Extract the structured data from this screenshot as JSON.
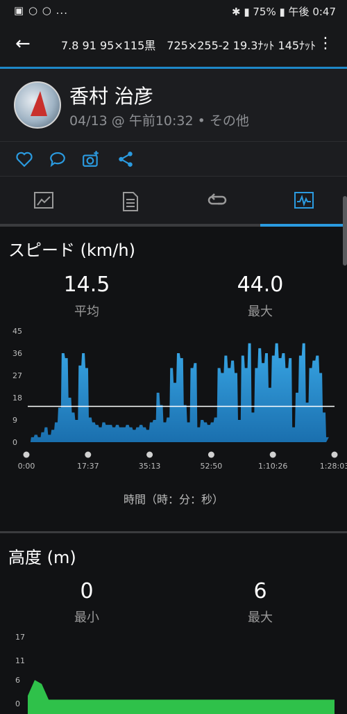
{
  "status_bar": {
    "left_icons": "▣ ○ ○ ...",
    "battery": "75%",
    "time": "午後 0:47"
  },
  "app_bar": {
    "title": "7.8 91 95×115黒　725×255-2 19.3ﾅｯﾄ 145ﾅｯﾄ"
  },
  "activity": {
    "user_name": "香村 治彦",
    "subtitle": "04/13 @ 午前10:32 • その他"
  },
  "speed": {
    "title": "スピード (km/h)",
    "avg_value": "14.5",
    "avg_label": "平均",
    "max_value": "44.0",
    "max_label": "最大",
    "x_axis_title": "時間（時：分：秒）"
  },
  "altitude": {
    "title": "高度 (m)",
    "min_value": "0",
    "min_label": "最小",
    "max_value": "6",
    "max_label": "最大"
  },
  "colors": {
    "accent": "#2b9be0",
    "speed_fill": "#2a8fcf",
    "altitude_fill": "#2fc14a"
  },
  "chart_data": [
    {
      "type": "area",
      "title": "スピード (km/h)",
      "xlabel": "時間（時：分：秒）",
      "ylabel": "",
      "ylim": [
        0,
        45
      ],
      "yticks": [
        0,
        9,
        18,
        27,
        36,
        45
      ],
      "xticks": [
        "0:00",
        "17:37",
        "35:13",
        "52:50",
        "1:10:26",
        "1:28:03"
      ],
      "average_line": 14.5,
      "x_minutes": [
        0,
        1,
        2,
        3,
        4,
        5,
        6,
        7,
        8,
        9,
        10,
        11,
        12,
        13,
        14,
        15,
        16,
        17,
        18,
        19,
        20,
        21,
        22,
        23,
        24,
        25,
        26,
        27,
        28,
        29,
        30,
        31,
        32,
        33,
        34,
        35,
        36,
        37,
        38,
        39,
        40,
        41,
        42,
        43,
        44,
        45,
        46,
        47,
        48,
        49,
        50,
        51,
        52,
        53,
        54,
        55,
        56,
        57,
        58,
        59,
        60,
        61,
        62,
        63,
        64,
        65,
        66,
        67,
        68,
        69,
        70,
        71,
        72,
        73,
        74,
        75,
        76,
        77,
        78,
        79,
        80,
        81,
        82,
        83,
        84,
        85,
        86,
        87,
        88
      ],
      "values": [
        0,
        2,
        3,
        2,
        4,
        6,
        3,
        5,
        8,
        14,
        36,
        34,
        18,
        12,
        9,
        31,
        36,
        30,
        10,
        8,
        7,
        6,
        8,
        7,
        7,
        6,
        7,
        6,
        6,
        7,
        6,
        5,
        6,
        7,
        6,
        5,
        8,
        9,
        20,
        15,
        8,
        10,
        30,
        24,
        36,
        34,
        15,
        8,
        30,
        32,
        6,
        9,
        8,
        7,
        8,
        10,
        30,
        28,
        35,
        30,
        33,
        28,
        9,
        35,
        30,
        40,
        12,
        30,
        38,
        32,
        36,
        22,
        35,
        40,
        34,
        36,
        30,
        34,
        6,
        20,
        35,
        40,
        16,
        30,
        33,
        35,
        28,
        12,
        2
      ],
      "series": [
        {
          "name": "",
          "values": []
        }
      ]
    },
    {
      "type": "area",
      "title": "高度 (m)",
      "ylim": [
        0,
        17
      ],
      "yticks": [
        0,
        6,
        11,
        17
      ],
      "x_minutes": [
        0,
        2,
        4,
        6,
        88
      ],
      "values": [
        2,
        6,
        5,
        1,
        1
      ]
    }
  ]
}
